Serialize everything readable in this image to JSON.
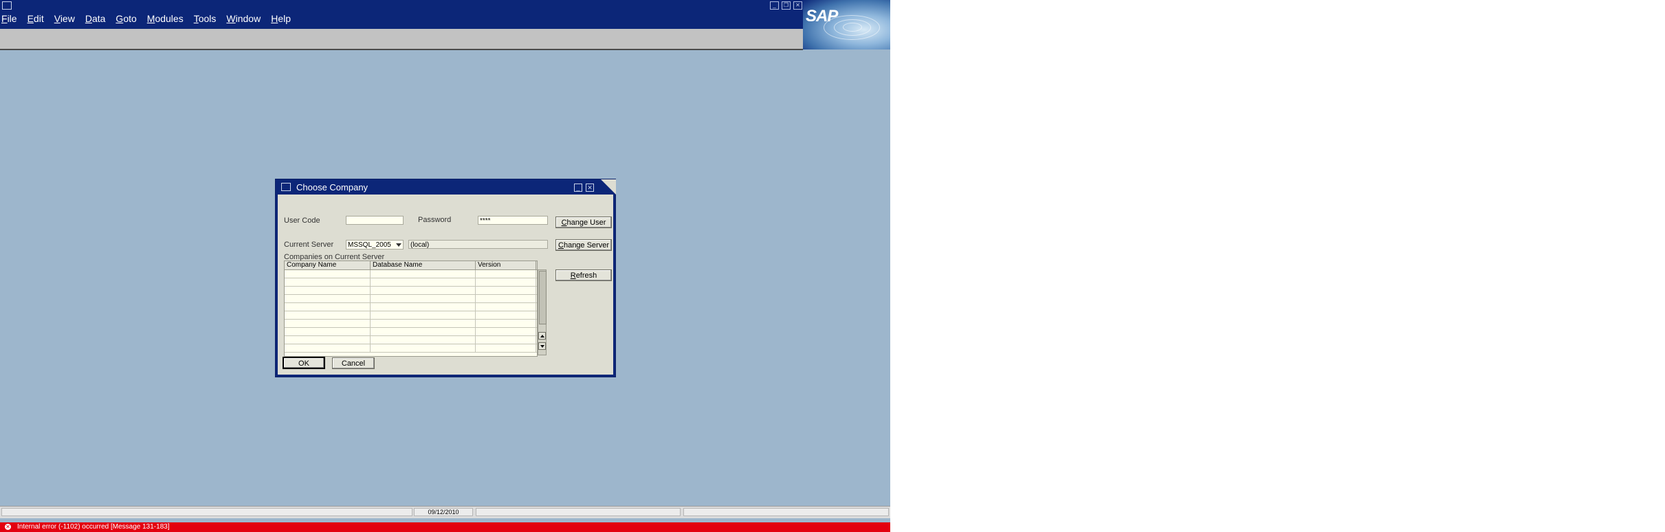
{
  "menubar": {
    "items": [
      {
        "label": "File",
        "mnemonic": "F",
        "rest": "ile"
      },
      {
        "label": "Edit",
        "mnemonic": "E",
        "rest": "dit"
      },
      {
        "label": "View",
        "mnemonic": "V",
        "rest": "iew"
      },
      {
        "label": "Data",
        "mnemonic": "D",
        "rest": "ata"
      },
      {
        "label": "Goto",
        "mnemonic": "G",
        "rest": "oto"
      },
      {
        "label": "Modules",
        "mnemonic": "M",
        "rest": "odules"
      },
      {
        "label": "Tools",
        "mnemonic": "T",
        "rest": "ools"
      },
      {
        "label": "Window",
        "mnemonic": "W",
        "rest": "indow"
      },
      {
        "label": "Help",
        "mnemonic": "H",
        "rest": "elp"
      }
    ],
    "logo_text": "SAP"
  },
  "dialog": {
    "title": "Choose Company",
    "user_code_label": "User Code",
    "user_code_value": "",
    "password_label": "Password",
    "password_value": "****",
    "change_user_button": {
      "mnemonic": "C",
      "rest": "hange User"
    },
    "current_server_label": "Current Server",
    "server_type": "MSSQL_2005",
    "server_name": "(local)",
    "change_server_button": {
      "mnemonic": "C",
      "rest": "hange Server"
    },
    "companies_label": "Companies on Current Server",
    "columns": [
      "Company Name",
      "Database Name",
      "Version"
    ],
    "rows": [
      [
        "",
        "",
        ""
      ],
      [
        "",
        "",
        ""
      ],
      [
        "",
        "",
        ""
      ],
      [
        "",
        "",
        ""
      ],
      [
        "",
        "",
        ""
      ],
      [
        "",
        "",
        ""
      ],
      [
        "",
        "",
        ""
      ],
      [
        "",
        "",
        ""
      ],
      [
        "",
        "",
        ""
      ],
      [
        "",
        "",
        ""
      ]
    ],
    "refresh_button": {
      "mnemonic": "R",
      "rest": "efresh"
    },
    "ok_button": "OK",
    "cancel_button": "Cancel"
  },
  "statusbar": {
    "date": "09/12/2010",
    "error_message": "Internal error (-1102) occurred  [Message 131-183]",
    "colors": {
      "error": "#e3000f",
      "titlebar": "#0c2678",
      "desktop": "#9db6cc"
    }
  }
}
